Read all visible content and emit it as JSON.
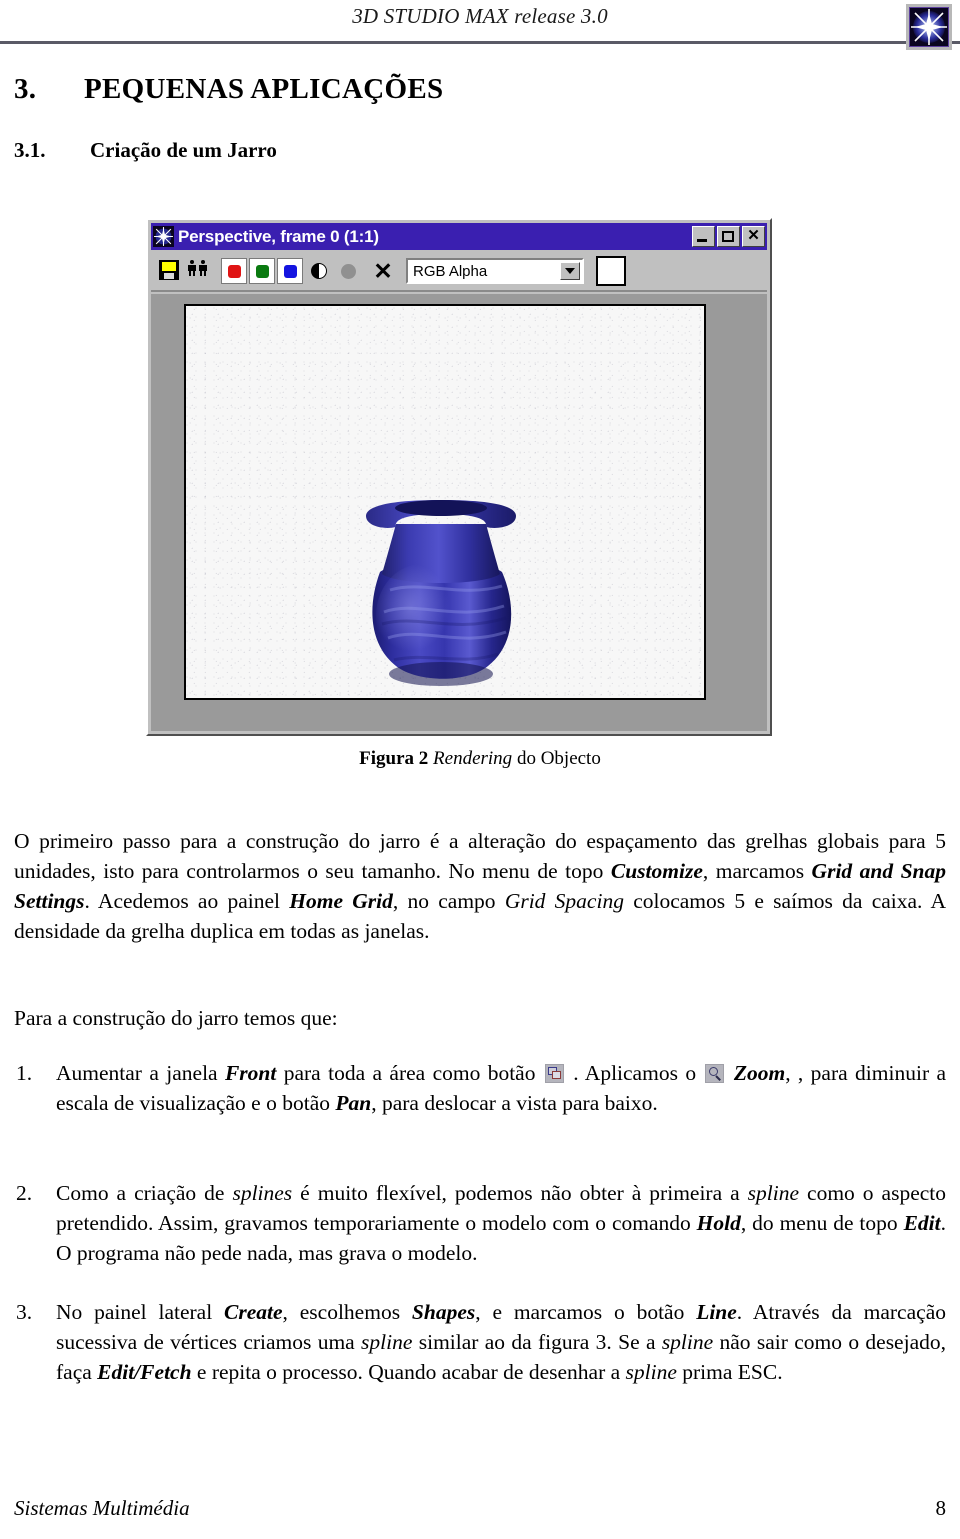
{
  "header": {
    "running_title": "3D STUDIO MAX release 3.0",
    "logo_icon": "3dsmax-star-logo-icon"
  },
  "headings": {
    "h1_number": "3.",
    "h1_title": "PEQUENAS APLICAÇÕES",
    "h2_number": "3.1.",
    "h2_title": "Criação de um Jarro"
  },
  "figure": {
    "window": {
      "title": "Perspective, frame 0 (1:1)",
      "title_icon": "3dsmax-star-icon",
      "controls": {
        "minimize": "_",
        "maximize": "□",
        "close": "✕"
      },
      "toolbar": {
        "save_icon": "floppy-disk-save-icon",
        "clone_icon": "clone-people-icon",
        "channels": [
          {
            "name": "red-channel-button",
            "color": "#e01414"
          },
          {
            "name": "green-channel-button",
            "color": "#0a7a10"
          },
          {
            "name": "blue-channel-button",
            "color": "#1414e0"
          }
        ],
        "mono_icon": "monochrome-half-circle-icon",
        "alpha_icon": "alpha-channel-circle-icon",
        "clear_icon": "clear-x-icon",
        "channel_select_value": "RGB Alpha",
        "channel_select_options": [
          "RGB Alpha"
        ],
        "color_swatch": "#ffffff"
      },
      "render_background": "#f7f7f7",
      "object_color": "#2b2b9e"
    },
    "caption_label": "Figura 2",
    "caption_italic": "Rendering",
    "caption_rest": "do Objecto"
  },
  "body": {
    "paragraph1": {
      "part1": "O primeiro passo para a construção do jarro é a alteração do espaçamento das grelhas globais para 5 unidades, isto para controlarmos o seu tamanho. No menu de topo ",
      "em1": "Customize",
      "part2": ", marcamos ",
      "em2": "Grid and Snap Settings",
      "part3": ". Acedemos ao painel ",
      "em3": "Home Grid",
      "part4": ", no campo ",
      "em4": "Grid Spacing",
      "part5": " colocamos 5 e saímos da caixa. A densidade da grelha duplica em todas as janelas."
    },
    "paragraph2": "Para a construção do jarro temos que:"
  },
  "list": [
    {
      "number": "1.",
      "part1": "Aumentar a janela ",
      "em1": "Front",
      "part2": " para toda a área como botão ",
      "icon1": "minmax-toggle-icon",
      "part3": " .   Aplicamos   o ",
      "icon2": "zoom-magnifier-icon",
      "part4": " ",
      "em2": "Zoom",
      "part5": ", , para diminuir a escala de visualização e o botão ",
      "em3": "Pan",
      "part6": ", para deslocar a vista para baixo."
    },
    {
      "number": "2.",
      "part1": "Como a criação de ",
      "em1": "splines",
      "part2": " é muito flexível, podemos não obter à primeira a ",
      "em2": "spline",
      "part3": " como o aspecto pretendido. Assim, gravamos temporariamente o modelo com o comando ",
      "em3": "Hold",
      "part4": ", do menu de topo ",
      "em4": "Edit",
      "part5": ". O programa não pede nada, mas grava o modelo."
    },
    {
      "number": "3.",
      "part1": "No painel lateral ",
      "em1": "Create",
      "part2": ", escolhemos ",
      "em2": "Shapes",
      "part3": ", e marcamos o botão ",
      "em3": "Line",
      "part4": ". Através da marcação sucessiva de vértices criamos uma ",
      "em4": "spline",
      "part5": " similar ao da figura 3. Se a ",
      "em5": "spline",
      "part6": " não sair como o desejado, faça ",
      "em6": "Edit/Fetch",
      "part7": " e repita o processo. Quando acabar de desenhar a ",
      "em7": "spline",
      "part8": " prima ESC."
    }
  ],
  "footer": {
    "title": "Sistemas Multimédia",
    "page_number": "8"
  }
}
